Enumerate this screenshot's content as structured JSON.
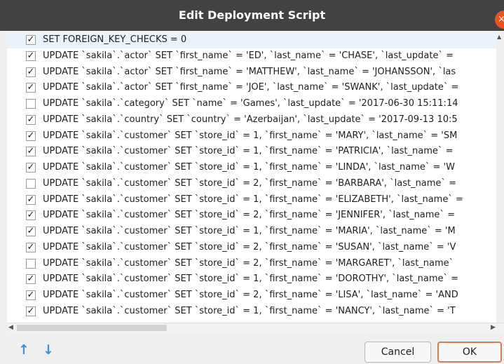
{
  "window": {
    "title": "Edit Deployment Script"
  },
  "statements": [
    {
      "checked": true,
      "selected": true,
      "text": "SET FOREIGN_KEY_CHECKS = 0"
    },
    {
      "checked": true,
      "selected": false,
      "text": "UPDATE `sakila`.`actor` SET `first_name` = 'ED', `last_name` = 'CHASE', `last_update` ="
    },
    {
      "checked": true,
      "selected": false,
      "text": "UPDATE `sakila`.`actor` SET `first_name` = 'MATTHEW', `last_name` = 'JOHANSSON', `las"
    },
    {
      "checked": true,
      "selected": false,
      "text": "UPDATE `sakila`.`actor` SET `first_name` = 'JOE', `last_name` = 'SWANK', `last_update` ="
    },
    {
      "checked": false,
      "selected": false,
      "text": "UPDATE `sakila`.`category` SET `name` = 'Games', `last_update` = '2017-06-30 15:11:14"
    },
    {
      "checked": true,
      "selected": false,
      "text": "UPDATE `sakila`.`country` SET `country` = 'Azerbaijan', `last_update` = '2017-09-13 10:5"
    },
    {
      "checked": true,
      "selected": false,
      "text": "UPDATE `sakila`.`customer` SET `store_id` = 1, `first_name` = 'MARY', `last_name` = 'SM"
    },
    {
      "checked": true,
      "selected": false,
      "text": "UPDATE `sakila`.`customer` SET `store_id` = 1, `first_name` = 'PATRICIA', `last_name` ="
    },
    {
      "checked": true,
      "selected": false,
      "text": "UPDATE `sakila`.`customer` SET `store_id` = 1, `first_name` = 'LINDA', `last_name` = 'W"
    },
    {
      "checked": false,
      "selected": false,
      "text": "UPDATE `sakila`.`customer` SET `store_id` = 2, `first_name` = 'BARBARA', `last_name` ="
    },
    {
      "checked": true,
      "selected": false,
      "text": "UPDATE `sakila`.`customer` SET `store_id` = 1, `first_name` = 'ELIZABETH', `last_name` ="
    },
    {
      "checked": true,
      "selected": false,
      "text": "UPDATE `sakila`.`customer` SET `store_id` = 2, `first_name` = 'JENNIFER', `last_name` ="
    },
    {
      "checked": true,
      "selected": false,
      "text": "UPDATE `sakila`.`customer` SET `store_id` = 1, `first_name` = 'MARIA', `last_name` = 'M"
    },
    {
      "checked": true,
      "selected": false,
      "text": "UPDATE `sakila`.`customer` SET `store_id` = 2, `first_name` = 'SUSAN', `last_name` = 'V"
    },
    {
      "checked": false,
      "selected": false,
      "text": "UPDATE `sakila`.`customer` SET `store_id` = 2, `first_name` = 'MARGARET', `last_name`"
    },
    {
      "checked": true,
      "selected": false,
      "text": "UPDATE `sakila`.`customer` SET `store_id` = 1, `first_name` = 'DOROTHY', `last_name` ="
    },
    {
      "checked": true,
      "selected": false,
      "text": "UPDATE `sakila`.`customer` SET `store_id` = 2, `first_name` = 'LISA', `last_name` = 'AND"
    },
    {
      "checked": true,
      "selected": false,
      "text": "UPDATE `sakila`.`customer` SET `store_id` = 1, `first_name` = 'NANCY', `last_name` = 'T"
    }
  ],
  "footer": {
    "move_up_icon": "↑",
    "move_down_icon": "↓",
    "cancel_label": "Cancel",
    "ok_label": "OK"
  },
  "icons": {
    "close": "×",
    "check": "✓",
    "scroll_up": "▲",
    "scroll_left": "◀",
    "scroll_right": "▶"
  },
  "colors": {
    "titlebar": "#424242",
    "close_button": "#e9541f",
    "arrow_accent": "#3d8fe0",
    "ok_border": "#d08050"
  }
}
